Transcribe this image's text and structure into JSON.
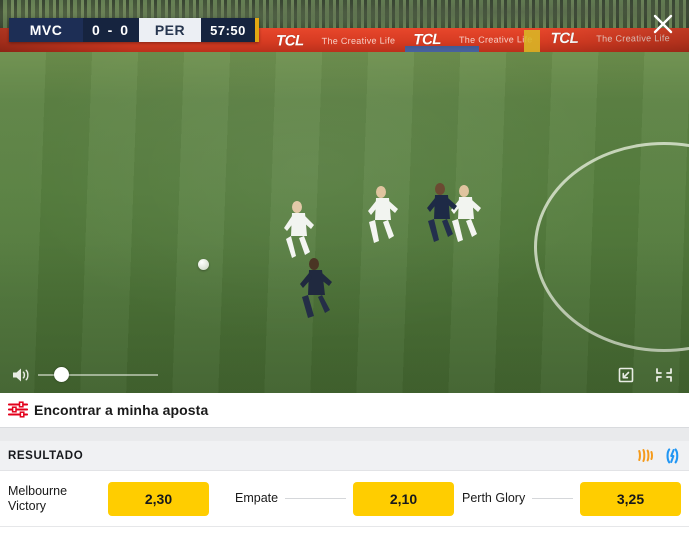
{
  "video": {
    "scoreboard": {
      "home_abbr": "MVC",
      "score": "0 - 0",
      "away_abbr": "PER",
      "clock": "57:50"
    },
    "advert": {
      "brand": "TCL",
      "tagline": "The Creative Life"
    },
    "close_label": "×",
    "controls": {
      "volume_icon": "volume-icon",
      "volume_value": "12",
      "pip_icon": "picture-in-picture-icon",
      "collapse_icon": "collapse-icon"
    }
  },
  "findbet": {
    "label": "Encontrar a minha aposta",
    "icon": "filter-sliders-icon"
  },
  "market": {
    "title": "RESULTADO",
    "icons": {
      "stats": "stats-icon",
      "graph": "graph-icon"
    },
    "selections": [
      {
        "name": "Melbourne Victory",
        "odds": "2,30"
      },
      {
        "name": "Empate",
        "odds": "2,10"
      },
      {
        "name": "Perth Glory",
        "odds": "3,25"
      }
    ]
  },
  "colors": {
    "odds_yellow": "#ffcd00",
    "accent_red": "#e3001b",
    "stats_orange": "#f59b1c",
    "graph_blue": "#2196f3",
    "scoreboard_navy": "#1d2e55"
  }
}
